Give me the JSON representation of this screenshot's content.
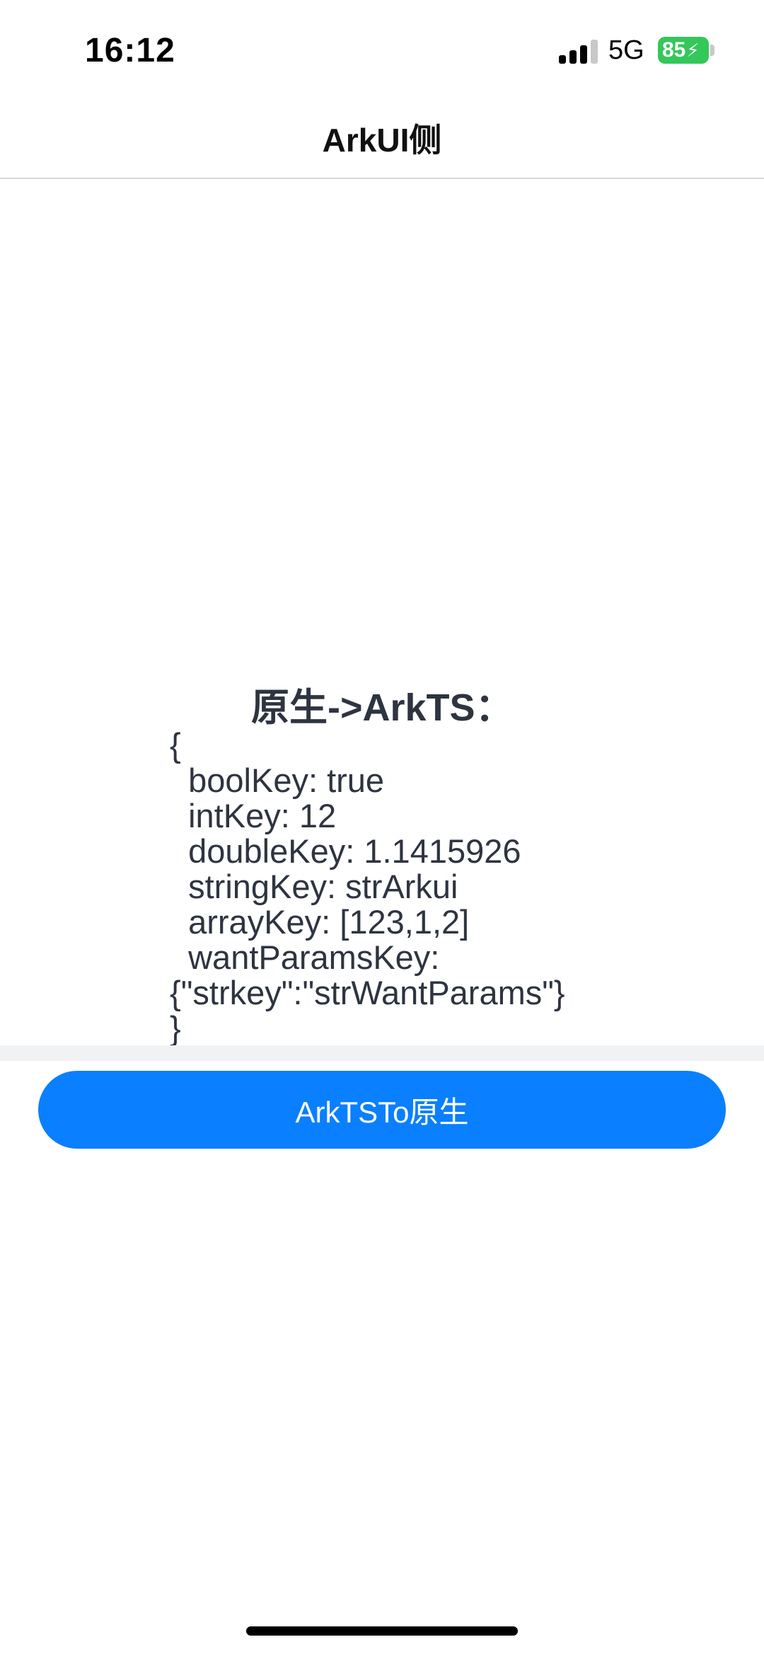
{
  "status_bar": {
    "time": "16:12",
    "network": "5G",
    "battery": "85",
    "battery_color": "#34c759"
  },
  "nav": {
    "title": "ArkUI侧"
  },
  "content": {
    "heading": "原生->ArkTS：",
    "body": "{\n  boolKey: true\n  intKey: 12\n  doubleKey: 1.1415926\n  stringKey: strArkui\n  arrayKey: [123,1,2]\n  wantParamsKey:\n{\"strkey\":\"strWantParams\"}\n}"
  },
  "action_button": {
    "label": "ArkTSTo原生",
    "color": "#0a7fff"
  }
}
